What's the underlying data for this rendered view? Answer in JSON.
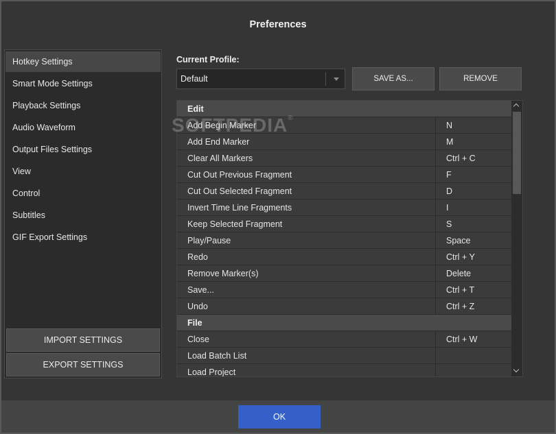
{
  "window": {
    "title": "Preferences"
  },
  "sidebar": {
    "items": [
      {
        "label": "Hotkey Settings",
        "active": true
      },
      {
        "label": "Smart Mode Settings"
      },
      {
        "label": "Playback Settings"
      },
      {
        "label": "Audio Waveform"
      },
      {
        "label": "Output Files Settings"
      },
      {
        "label": "View"
      },
      {
        "label": "Control"
      },
      {
        "label": "Subtitles"
      },
      {
        "label": "GIF Export Settings"
      }
    ],
    "import_label": "IMPORT SETTINGS",
    "export_label": "EXPORT SETTINGS"
  },
  "profile": {
    "label": "Current Profile:",
    "value": "Default",
    "save_as_label": "SAVE AS...",
    "remove_label": "REMOVE"
  },
  "watermark": {
    "text": "SOFTPEDIA",
    "mark": "®"
  },
  "hotkeys": {
    "rows": [
      {
        "type": "group",
        "command": "Edit",
        "key": ""
      },
      {
        "type": "item",
        "command": "Add Begin Marker",
        "key": "N"
      },
      {
        "type": "item",
        "command": "Add End Marker",
        "key": "M"
      },
      {
        "type": "item",
        "command": "Clear All Markers",
        "key": "Ctrl + C"
      },
      {
        "type": "item",
        "command": "Cut Out Previous Fragment",
        "key": "F"
      },
      {
        "type": "item",
        "command": "Cut Out Selected Fragment",
        "key": "D"
      },
      {
        "type": "item",
        "command": "Invert Time Line Fragments",
        "key": "I"
      },
      {
        "type": "item",
        "command": "Keep Selected Fragment",
        "key": "S"
      },
      {
        "type": "item",
        "command": "Play/Pause",
        "key": "Space"
      },
      {
        "type": "item",
        "command": "Redo",
        "key": "Ctrl + Y"
      },
      {
        "type": "item",
        "command": "Remove Marker(s)",
        "key": "Delete"
      },
      {
        "type": "item",
        "command": "Save...",
        "key": "Ctrl + T"
      },
      {
        "type": "item",
        "command": "Undo",
        "key": "Ctrl + Z"
      },
      {
        "type": "group",
        "command": "File",
        "key": ""
      },
      {
        "type": "item",
        "command": "Close",
        "key": "Ctrl + W"
      },
      {
        "type": "item",
        "command": "Load Batch List",
        "key": ""
      },
      {
        "type": "item",
        "command": "Load Project",
        "key": ""
      }
    ]
  },
  "footer": {
    "ok_label": "OK"
  },
  "colors": {
    "accent": "#3460c8",
    "background": "#353535",
    "row": "#3b3b3b",
    "group_row": "#4a4a4a"
  }
}
